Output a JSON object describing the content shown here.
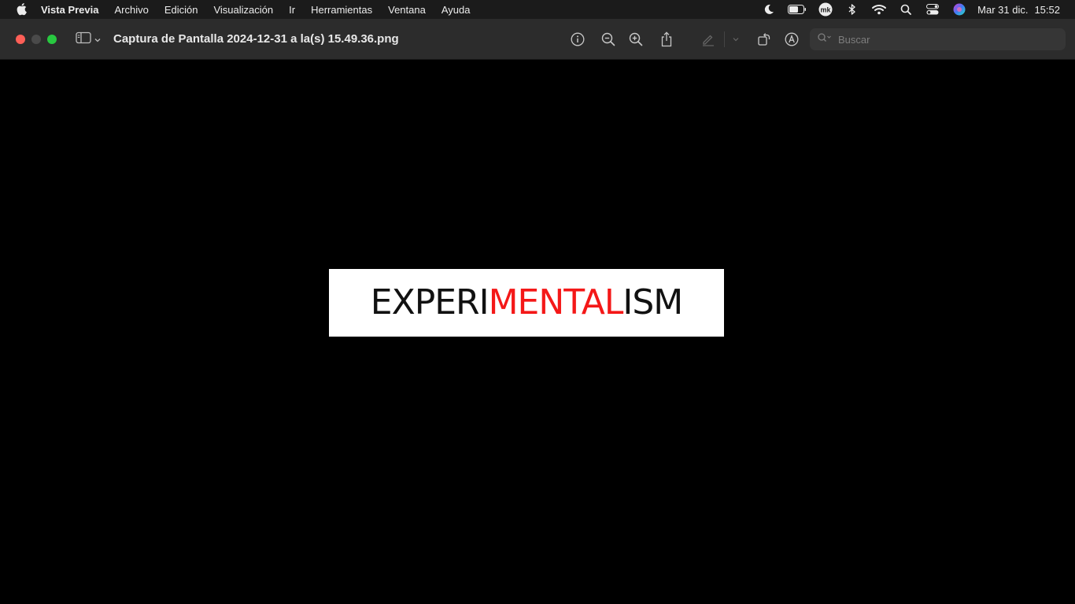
{
  "menubar": {
    "app_name": "Vista Previa",
    "items": [
      "Archivo",
      "Edición",
      "Visualización",
      "Ir",
      "Herramientas",
      "Ventana",
      "Ayuda"
    ],
    "status_icons": [
      "moon-icon",
      "battery-icon",
      "mk-keyboard-icon",
      "bluetooth-icon",
      "wifi-icon",
      "spotlight-search-icon",
      "control-center-icon",
      "siri-icon"
    ],
    "date": "Mar 31 dic.",
    "time": "15:52",
    "badge_text": "mk"
  },
  "window": {
    "title": "Captura de Pantalla 2024-12-31 a la(s) 15.49.36.png",
    "search_placeholder": "Buscar",
    "toolbar_icons": [
      "info-icon",
      "zoom-out-icon",
      "zoom-in-icon",
      "share-icon",
      "markup-pen-icon",
      "chevron-down-icon",
      "rotate-icon",
      "annotate-icon"
    ]
  },
  "image_content": {
    "part1": "EXPERI",
    "part2": "MENTAL",
    "part3": "ISM"
  },
  "colors": {
    "accent_red": "#f41818",
    "close": "#fe5f57",
    "zoom": "#28c840"
  }
}
